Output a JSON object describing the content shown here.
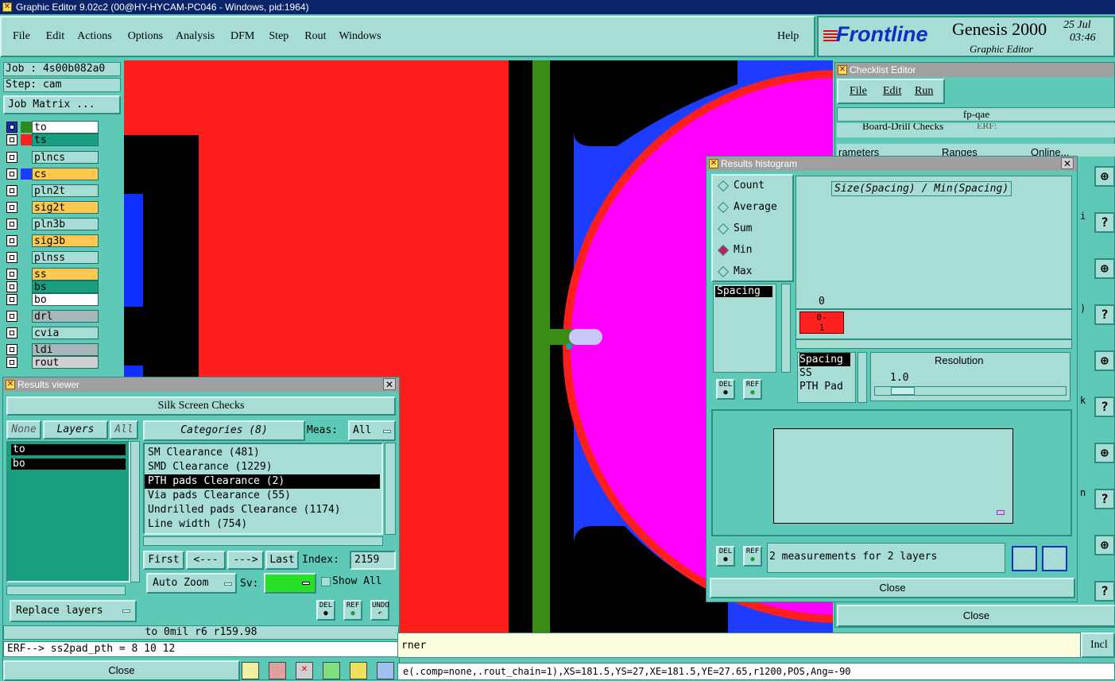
{
  "app": {
    "title": "Graphic Editor 9.02c2 (00@HY-HYCAM-PC046 - Windows, pid:1964)",
    "menu": [
      "File",
      "Edit",
      "Actions",
      "Options",
      "Analysis",
      "DFM",
      "Step",
      "Rout",
      "Windows"
    ],
    "help": "Help",
    "brand": "Frontline",
    "product": "Genesis 2000",
    "subtitle": "Graphic Editor",
    "date": "25 Jul",
    "time": "03:46"
  },
  "job": {
    "job": "Job : 4s00b082a0",
    "step": "Step: cam",
    "matrix_btn": "Job Matrix ..."
  },
  "layers": [
    {
      "name": "to",
      "color": "#2e8b1e",
      "bg": "#ffffff",
      "sel": true
    },
    {
      "name": "ts",
      "color": "#ff2020",
      "bg": "#1a9e80"
    },
    {
      "name": "plncs",
      "color": "",
      "bg": "#a8ddd6"
    },
    {
      "name": "cs",
      "color": "#1e3cff",
      "bg": "#ffc850"
    },
    {
      "name": "pln2t",
      "color": "",
      "bg": "#a8ddd6"
    },
    {
      "name": "sig2t",
      "color": "",
      "bg": "#ffc850"
    },
    {
      "name": "pln3b",
      "color": "",
      "bg": "#a8ddd6"
    },
    {
      "name": "sig3b",
      "color": "",
      "bg": "#ffc850"
    },
    {
      "name": "plnss",
      "color": "",
      "bg": "#a8ddd6"
    },
    {
      "name": "ss",
      "color": "",
      "bg": "#ffc850"
    },
    {
      "name": "bs",
      "color": "",
      "bg": "#1a9e80"
    },
    {
      "name": "bo",
      "color": "",
      "bg": "#ffffff"
    },
    {
      "name": "drl",
      "color": "",
      "bg": "#a8b8b8"
    },
    {
      "name": "cvia",
      "color": "",
      "bg": "#a8ddd6"
    },
    {
      "name": "ldi",
      "color": "",
      "bg": "#a8b8b8"
    },
    {
      "name": "rout",
      "color": "",
      "bg": "#d0d0d0"
    }
  ],
  "results_viewer": {
    "title": "Results viewer",
    "header": "Silk Screen Checks",
    "none_btn": "None",
    "layers_label": "Layers",
    "all_btn": "All",
    "layer_list": [
      "to",
      "bo"
    ],
    "categories_label": "Categories (8)",
    "meas_label": "Meas:",
    "meas_value": "All",
    "categories": [
      "SM Clearance (481)",
      "SMD Clearance (1229)",
      "PTH pads Clearance (2)",
      "Via pads Clearance (55)",
      "Undrilled pads Clearance (1174)",
      "Line width (754)"
    ],
    "selected_category": 2,
    "first_btn": "First",
    "prev_btn": "<---",
    "next_btn": "--->",
    "last_btn": "Last",
    "index_label": "Index:",
    "index_value": "2159",
    "autozoom": "Auto Zoom",
    "sv_label": "Sv:",
    "show_all": "Show All",
    "replace": "Replace layers",
    "status1": "to 0mil  r6  r159.98",
    "status2": "ERF--> ss2pad_pth = 8 10 12",
    "close": "Close",
    "del": "DEL",
    "ref": "REF",
    "undo": "UNDO"
  },
  "histogram": {
    "title": "Results histogram",
    "options": [
      "Count",
      "Average",
      "Sum",
      "Min",
      "Max"
    ],
    "selected_option": 3,
    "chart_title": "Size(Spacing) / Min(Spacing)",
    "bar_value": "0",
    "bar_label": "0-\n1",
    "list": [
      "Spacing"
    ],
    "attrs": [
      "Spacing",
      "SS",
      "PTH Pad"
    ],
    "resolution_label": "Resolution",
    "resolution_value": "1.0",
    "measurements": "2 measurements for 2 layers",
    "close": "Close",
    "del": "DEL",
    "ref": "REF"
  },
  "checklist": {
    "title": "Checklist Editor",
    "menu": [
      "File",
      "Edit",
      "Run"
    ],
    "name": "fp-qae",
    "row_text": "Board-Drill Checks",
    "erf": "ERF:",
    "col1": "rameters",
    "col2": "Ranges",
    "col3": "Online...",
    "close": "Close",
    "side_letters": [
      "i",
      ")",
      "k",
      "n"
    ],
    "side_e": "e..."
  },
  "bottom": {
    "corner": "rner",
    "incl": "Incl",
    "cmd": "e(.comp=none,.rout_chain=1),XS=181.5,YS=27,XE=181.5,YE=27.65,r1200,POS,Ang=-90"
  }
}
